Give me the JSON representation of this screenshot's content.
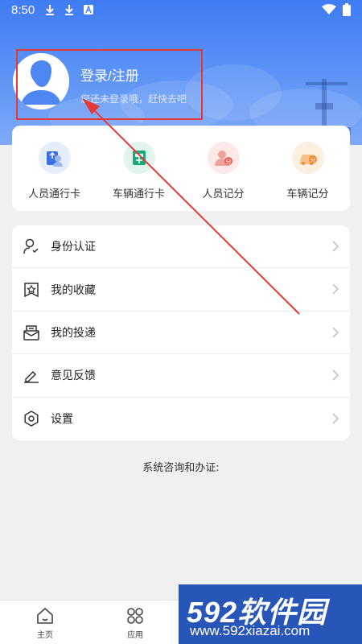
{
  "status_bar": {
    "time": "8:50",
    "icons": [
      "download-icon",
      "download-icon",
      "app-icon",
      "wifi-icon",
      "battery-icon"
    ]
  },
  "profile": {
    "title": "登录/注册",
    "subtitle": "您还未登录哦，赶快去吧"
  },
  "quick_actions": [
    {
      "label": "人员通行卡",
      "icon": "person-pass-icon",
      "color": "#3e6fe0",
      "bg": "#e6eefc"
    },
    {
      "label": "车辆通行卡",
      "icon": "vehicle-pass-icon",
      "color": "#19a97b",
      "bg": "#e1f5ee"
    },
    {
      "label": "人员记分",
      "icon": "person-score-icon",
      "color": "#e0655b",
      "bg": "#fde9e7"
    },
    {
      "label": "车辆记分",
      "icon": "vehicle-score-icon",
      "color": "#f08a2a",
      "bg": "#fdefe0"
    }
  ],
  "menu": [
    {
      "label": "身份认证",
      "icon": "identity-icon"
    },
    {
      "label": "我的收藏",
      "icon": "favorite-icon"
    },
    {
      "label": "我的投递",
      "icon": "delivery-icon"
    },
    {
      "label": "意见反馈",
      "icon": "feedback-icon"
    },
    {
      "label": "设置",
      "icon": "settings-icon"
    }
  ],
  "consult_text": "系统咨询和办证:",
  "bottom_nav": [
    {
      "label": "主页",
      "icon": "home-icon"
    },
    {
      "label": "应用",
      "icon": "apps-icon"
    }
  ],
  "watermark": {
    "main": "592软件园",
    "url": "www.592xiazai.com"
  },
  "colors": {
    "header": "#4a86f5",
    "highlight": "#e53935"
  }
}
